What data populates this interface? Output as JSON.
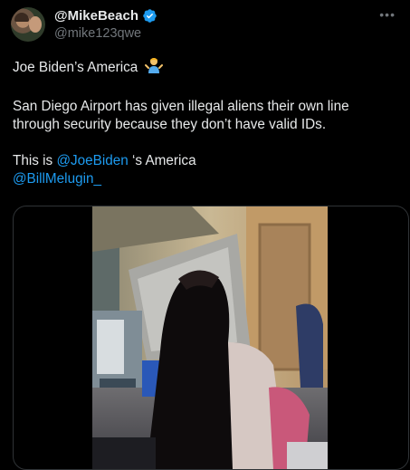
{
  "author": {
    "display_name": "@MikeBeach",
    "handle": "@mike123qwe",
    "verified": true
  },
  "tweet": {
    "line1": "Joe Biden’s America",
    "emoji": "person-shrugging-emoji",
    "line2": "San Diego Airport has given illegal aliens their own line through security because they don’t have valid IDs.",
    "line3_prefix": "This is ",
    "mention1": "@JoeBiden",
    "line3_suffix": " ‘s America",
    "mention2": "@BillMelugin_"
  },
  "colors": {
    "background": "#000000",
    "text": "#e7e9ea",
    "secondary": "#71767b",
    "link": "#1d9bf0",
    "verified": "#1d9bf0"
  },
  "icons": {
    "verified": "verified-badge-icon",
    "more": "more-options-icon"
  }
}
